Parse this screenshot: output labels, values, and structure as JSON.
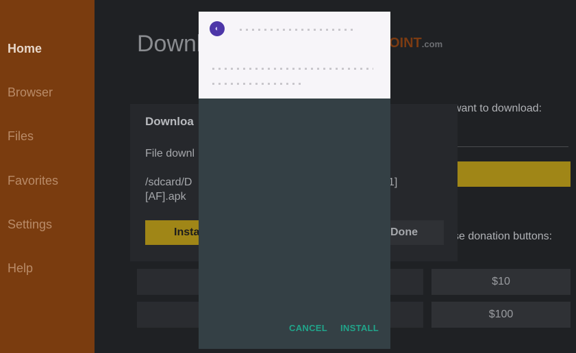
{
  "sidebar": {
    "items": [
      {
        "label": "Home",
        "active": true
      },
      {
        "label": "Browser"
      },
      {
        "label": "Files"
      },
      {
        "label": "Favorites"
      },
      {
        "label": "Settings"
      },
      {
        "label": "Help"
      }
    ]
  },
  "main": {
    "title": "Downl",
    "logo_text": "OINT",
    "logo_suffix": ".com",
    "url_prompt": "want to download:",
    "donation_prompt": "se donation buttons:",
    "donation_buttons": [
      "$10",
      "$100"
    ]
  },
  "download_panel": {
    "title": "Downloa",
    "file_status": "File downl",
    "path_line1": "/sdcard/D",
    "path_line1_end": "1]",
    "path_line2": "[AF].apk",
    "install_label": "Insta",
    "done_label": "Done"
  },
  "install_dialog": {
    "app_icon_glyph": "◐",
    "cancel_label": "CANCEL",
    "install_label": "INSTALL"
  },
  "colors": {
    "sidebar_bg": "#7a3c0f",
    "accent_yellow": "#a08617",
    "dialog_body": "#344045",
    "dialog_button_text": "#21a48a"
  }
}
